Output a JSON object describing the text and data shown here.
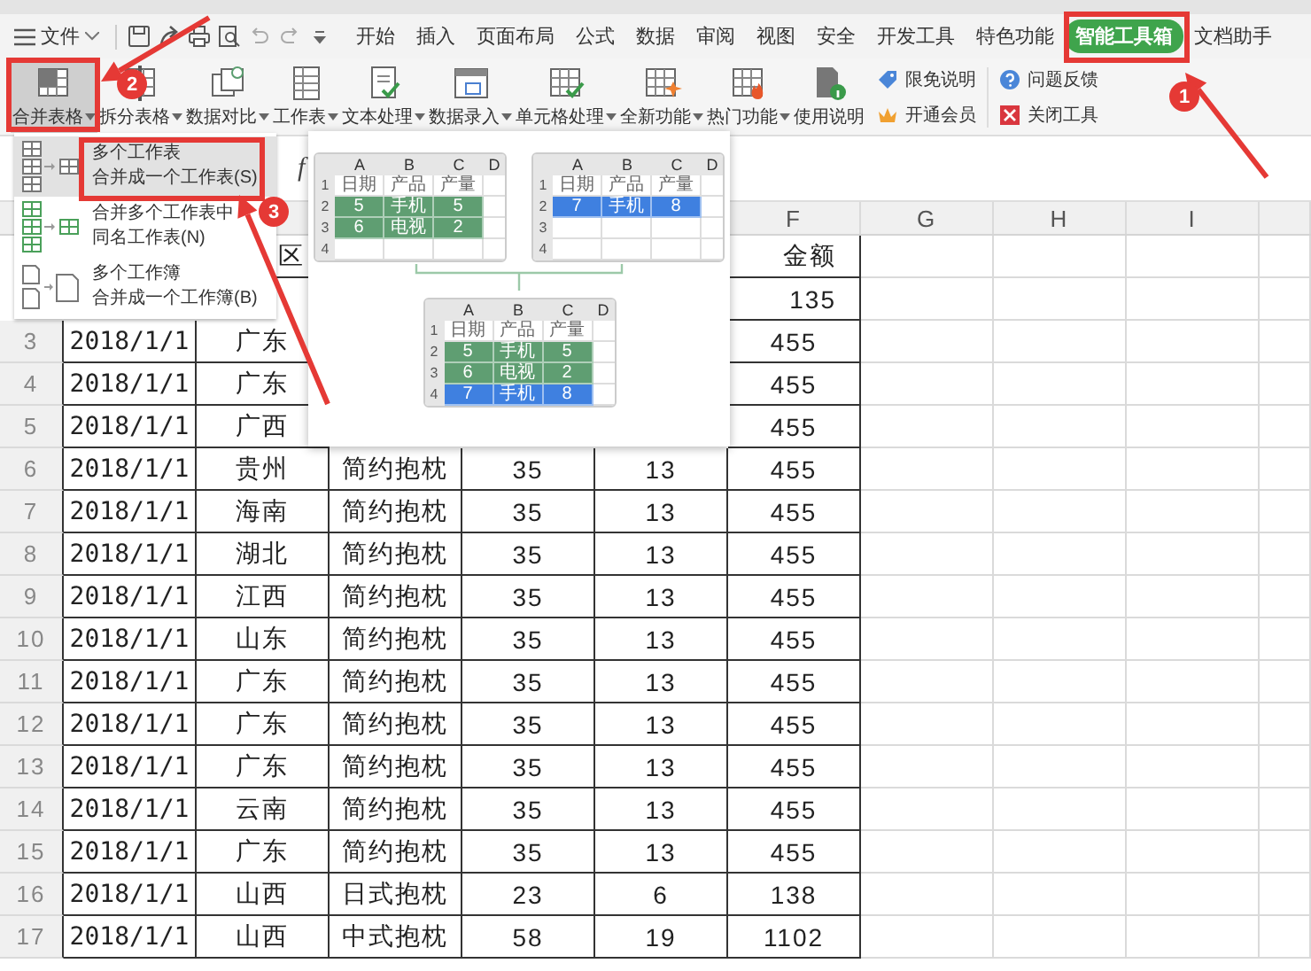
{
  "menu_bar": {
    "file_menu": "文件",
    "tabs": [
      {
        "label": "开始",
        "selected": false
      },
      {
        "label": "插入",
        "selected": false
      },
      {
        "label": "页面布局",
        "selected": false
      },
      {
        "label": "公式",
        "selected": false
      },
      {
        "label": "数据",
        "selected": false
      },
      {
        "label": "审阅",
        "selected": false
      },
      {
        "label": "视图",
        "selected": false
      },
      {
        "label": "安全",
        "selected": false
      },
      {
        "label": "开发工具",
        "selected": false
      },
      {
        "label": "特色功能",
        "selected": false
      },
      {
        "label": "智能工具箱",
        "selected": true
      },
      {
        "label": "文档助手",
        "selected": false
      }
    ]
  },
  "ribbon": {
    "items": [
      {
        "kind": "large",
        "label": "合并表格",
        "dropdown": true,
        "selected": true
      },
      {
        "kind": "large",
        "label": "拆分表格",
        "dropdown": true,
        "selected": false
      },
      {
        "kind": "large",
        "label": "数据对比",
        "dropdown": true,
        "selected": false
      },
      {
        "kind": "large",
        "label": "工作表",
        "dropdown": true,
        "selected": false
      },
      {
        "kind": "large",
        "label": "文本处理",
        "dropdown": true,
        "selected": false
      },
      {
        "kind": "large",
        "label": "数据录入",
        "dropdown": true,
        "selected": false
      },
      {
        "kind": "large",
        "label": "单元格处理",
        "dropdown": true,
        "selected": false
      },
      {
        "kind": "large",
        "label": "全新功能",
        "dropdown": true,
        "selected": false
      },
      {
        "kind": "large",
        "label": "热门功能",
        "dropdown": true,
        "selected": false
      },
      {
        "kind": "large",
        "label": "使用说明",
        "dropdown": false,
        "selected": false
      },
      {
        "kind": "small",
        "label": "限免说明"
      },
      {
        "kind": "small",
        "label": "开通会员"
      },
      {
        "kind": "small",
        "label": "问题反馈"
      },
      {
        "kind": "small",
        "label": "关闭工具"
      }
    ]
  },
  "formula_bar": {
    "function_label": "f"
  },
  "sheet": {
    "column_headers": [
      "F",
      "G",
      "H",
      "I"
    ],
    "rows": [
      {
        "cells": [
          null,
          "区",
          null,
          null,
          null,
          "金额"
        ]
      },
      {
        "cells": [
          null,
          null,
          null,
          null,
          null,
          "135"
        ]
      },
      {
        "number": "3",
        "cells": [
          "2018/1/1",
          "广东",
          null,
          null,
          null,
          "455"
        ]
      },
      {
        "number": "4",
        "cells": [
          "2018/1/1",
          "广东",
          null,
          null,
          null,
          "455"
        ]
      },
      {
        "number": "5",
        "cells": [
          "2018/1/1",
          "广西",
          null,
          null,
          null,
          "455"
        ]
      },
      {
        "number": "6",
        "cells": [
          "2018/1/1",
          "贵州",
          "简约抱枕",
          "35",
          "13",
          "455"
        ]
      },
      {
        "number": "7",
        "cells": [
          "2018/1/1",
          "海南",
          "简约抱枕",
          "35",
          "13",
          "455"
        ]
      },
      {
        "number": "8",
        "cells": [
          "2018/1/1",
          "湖北",
          "简约抱枕",
          "35",
          "13",
          "455"
        ]
      },
      {
        "number": "9",
        "cells": [
          "2018/1/1",
          "江西",
          "简约抱枕",
          "35",
          "13",
          "455"
        ]
      },
      {
        "number": "10",
        "cells": [
          "2018/1/1",
          "山东",
          "简约抱枕",
          "35",
          "13",
          "455"
        ]
      },
      {
        "number": "11",
        "cells": [
          "2018/1/1",
          "广东",
          "简约抱枕",
          "35",
          "13",
          "455"
        ]
      },
      {
        "number": "12",
        "cells": [
          "2018/1/1",
          "广东",
          "简约抱枕",
          "35",
          "13",
          "455"
        ]
      },
      {
        "number": "13",
        "cells": [
          "2018/1/1",
          "广东",
          "简约抱枕",
          "35",
          "13",
          "455"
        ]
      },
      {
        "number": "14",
        "cells": [
          "2018/1/1",
          "云南",
          "简约抱枕",
          "35",
          "13",
          "455"
        ]
      },
      {
        "number": "15",
        "cells": [
          "2018/1/1",
          "广东",
          "简约抱枕",
          "35",
          "13",
          "455"
        ]
      },
      {
        "number": "16",
        "cells": [
          "2018/1/1",
          "山西",
          "日式抱枕",
          "23",
          "6",
          "138"
        ]
      },
      {
        "number": "17",
        "cells": [
          "2018/1/1",
          "山西",
          "中式抱枕",
          "58",
          "19",
          "1102"
        ]
      }
    ]
  },
  "dropdown_menu": {
    "items": [
      {
        "lines": [
          "多个工作表",
          "合并成一个工作表(S)"
        ],
        "selected": true
      },
      {
        "lines": [
          "合并多个工作表中",
          "同名工作表(N)"
        ],
        "selected": false
      },
      {
        "lines": [
          "多个工作簿",
          "合并成一个工作簿(B)"
        ],
        "selected": false
      }
    ]
  },
  "preview": {
    "sources": [
      {
        "column_headers": [
          "A",
          "B",
          "C",
          "D"
        ],
        "rows": [
          {
            "number": "1",
            "cells": [
              "日期",
              "产品",
              "产量"
            ]
          },
          {
            "number": "2",
            "cells": [
              "5",
              "手机",
              "5"
            ],
            "color": "#5f9e72"
          },
          {
            "number": "3",
            "cells": [
              "6",
              "电视",
              "2"
            ],
            "color": "#5f9e72"
          },
          {
            "number": "4"
          }
        ]
      },
      {
        "column_headers": [
          "A",
          "B",
          "C",
          "D"
        ],
        "rows": [
          {
            "number": "1",
            "cells": [
              "日期",
              "产品",
              "产量"
            ]
          },
          {
            "number": "2",
            "cells": [
              "7",
              "手机",
              "8"
            ],
            "color": "#3f80e0"
          },
          {
            "number": "3"
          },
          {
            "number": "4"
          }
        ]
      }
    ],
    "result": {
      "column_headers": [
        "A",
        "B",
        "C",
        "D"
      ],
      "rows": [
        {
          "number": "1",
          "cells": [
            "日期",
            "产品",
            "产量"
          ]
        },
        {
          "number": "2",
          "cells": [
            "5",
            "手机",
            "5"
          ],
          "color": "#5f9e72"
        },
        {
          "number": "3",
          "cells": [
            "6",
            "电视",
            "2"
          ],
          "color": "#5f9e72"
        },
        {
          "number": "4",
          "cells": [
            "7",
            "手机",
            "8"
          ],
          "color": "#3f80e0"
        }
      ]
    }
  },
  "annotations": [
    {
      "number": "1"
    },
    {
      "number": "2"
    },
    {
      "number": "3"
    }
  ]
}
